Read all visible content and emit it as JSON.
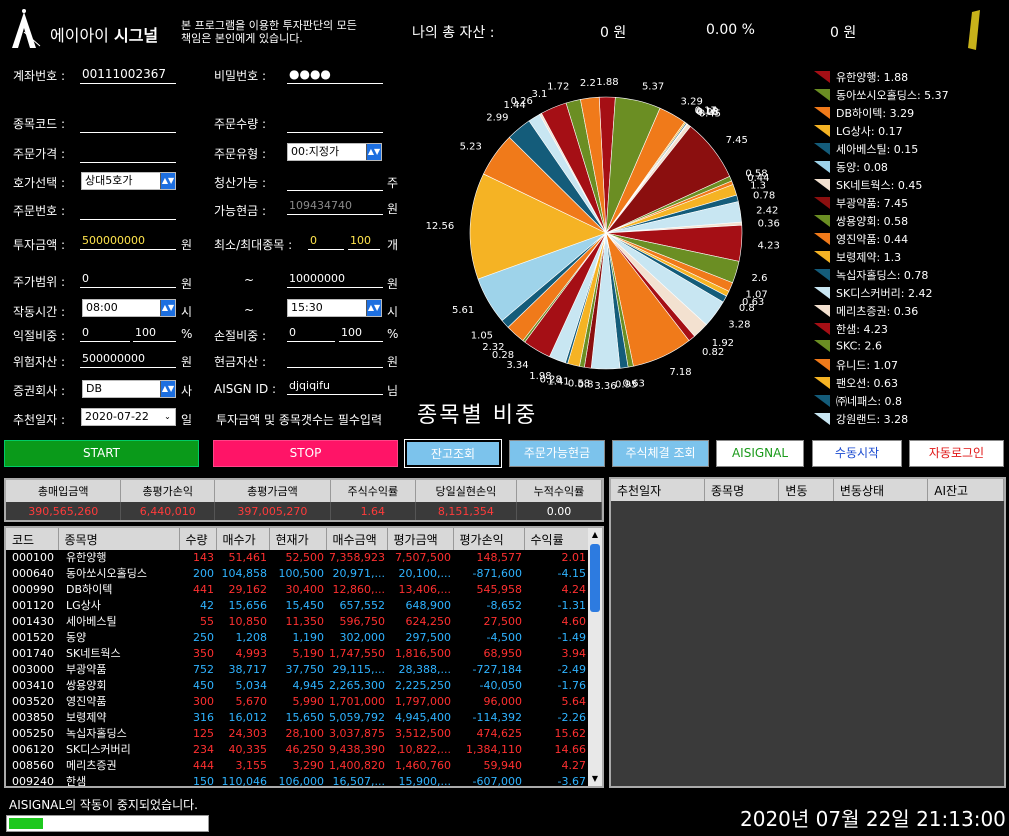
{
  "header": {
    "brand_ko": "에이아이",
    "brand_bold": "시그널",
    "disclaimer_line1": "본 프로그램을 이용한 투자판단의 모든",
    "disclaimer_line2": "책임은 본인에게 있습니다.",
    "total_asset_label": "나의 총 자산 :",
    "total_asset_value": "0 원",
    "total_rate": "0.00 %",
    "total_profit": "0 원"
  },
  "form": {
    "account_label": "계좌번호 :",
    "account_value": "00111002367",
    "password_label": "비밀번호 :",
    "password_value": "●●●●",
    "code_label": "종목코드 :",
    "code_value": "",
    "qty_label": "주문수량 :",
    "qty_value": "",
    "price_label": "주문가격 :",
    "price_value": "",
    "order_type_label": "주문유형 :",
    "order_type_value": "00:지정가",
    "hoga_label": "호가선택 :",
    "hoga_value": "상대5호가",
    "liquidation_label": "청산가능 :",
    "liquidation_value": "",
    "liquidation_unit": "주",
    "order_no_label": "주문번호 :",
    "order_no_value": "",
    "available_cash_label": "가능현금 :",
    "available_cash_value": "109434740",
    "available_cash_unit": "원",
    "invest_label": "투자금액 :",
    "invest_value": "500000000",
    "invest_unit": "원",
    "minmax_label": "최소/최대종목 :",
    "min_value": "0",
    "max_value": "100",
    "minmax_unit": "개",
    "price_range_label": "주가범위 :",
    "price_from": "0",
    "price_from_unit": "원",
    "tilde1": "~",
    "price_to": "10000000",
    "price_to_unit": "원",
    "time_label": "작동시간 :",
    "time_from": "08:00",
    "time_from_unit": "시",
    "tilde2": "~",
    "time_to": "15:30",
    "time_to_unit": "시",
    "takeprofit_label": "익절비중 :",
    "takeprofit_a": "0",
    "takeprofit_b": "100",
    "takeprofit_unit": "%",
    "stoploss_label": "손절비중 :",
    "stoploss_a": "0",
    "stoploss_b": "100",
    "stoploss_unit": "%",
    "risk_asset_label": "위험자산 :",
    "risk_asset_value": "500000000",
    "risk_asset_unit": "원",
    "cash_asset_label": "현금자산 :",
    "cash_asset_value": "",
    "cash_asset_unit": "원",
    "broker_label": "증권회사 :",
    "broker_value": "DB",
    "broker_unit": "사",
    "aisgn_label": "AISGN ID :",
    "aisgn_value": "djqiqifu",
    "aisgn_unit": "님",
    "recommend_label": "추천일자 :",
    "recommend_value": "2020-07-22",
    "recommend_unit": "일",
    "required_note": "투자금액 및 종목갯수는 필수입력"
  },
  "chart_title": "종목별 비중",
  "chart_data": {
    "type": "pie",
    "title": "종목별 비중",
    "slices": [
      {
        "label": "유한양행",
        "value": 1.88,
        "color": "#a50f15"
      },
      {
        "label": "동아쏘시오홀딩스",
        "value": 5.37,
        "color": "#6b8e23"
      },
      {
        "label": "DB하이텍",
        "value": 3.29,
        "color": "#f07a1a"
      },
      {
        "label": "LG상사",
        "value": 0.17,
        "color": "#f5b324"
      },
      {
        "label": "세아베스틸",
        "value": 0.15,
        "color": "#145c7a"
      },
      {
        "label": "동양",
        "value": 0.08,
        "color": "#9ed3ea"
      },
      {
        "label": "SK네트웍스",
        "value": 0.45,
        "color": "#f3e1d0"
      },
      {
        "label": "부광약품",
        "value": 7.45,
        "color": "#8b0f0f"
      },
      {
        "label": "쌍용양회",
        "value": 0.58,
        "color": "#6b8e23"
      },
      {
        "label": "영진약품",
        "value": 0.44,
        "color": "#f07a1a"
      },
      {
        "label": "보령제약",
        "value": 1.3,
        "color": "#f5b324"
      },
      {
        "label": "녹십자홀딩스",
        "value": 0.78,
        "color": "#145c7a"
      },
      {
        "label": "SK디스커버리",
        "value": 2.42,
        "color": "#c8e6f2"
      },
      {
        "label": "메리츠증권",
        "value": 0.36,
        "color": "#f3e1d0"
      },
      {
        "label": "한샘",
        "value": 4.23,
        "color": "#a50f15"
      },
      {
        "label": "SKC",
        "value": 2.6,
        "color": "#6b8e23"
      },
      {
        "label": "유니드",
        "value": 1.07,
        "color": "#f07a1a"
      },
      {
        "label": "팬오션",
        "value": 0.63,
        "color": "#f5b324"
      },
      {
        "label": "㈜네패스",
        "value": 0.8,
        "color": "#145c7a"
      },
      {
        "label": "강원랜드",
        "value": 3.28,
        "color": "#c8e6f2"
      },
      {
        "label": "",
        "value": 1.92,
        "color": "#f3e1d0"
      },
      {
        "label": "",
        "value": 0.82,
        "color": "#a50f15"
      },
      {
        "label": "",
        "value": 7.18,
        "color": "#f07a1a"
      },
      {
        "label": "",
        "value": 0.63,
        "color": "#6b8e23"
      },
      {
        "label": "",
        "value": 0.95,
        "color": "#145c7a"
      },
      {
        "label": "",
        "value": 3.36,
        "color": "#c8e6f2"
      },
      {
        "label": "",
        "value": 0.8,
        "color": "#8b0f0f"
      },
      {
        "label": "",
        "value": 0.58,
        "color": "#6b8e23"
      },
      {
        "label": "",
        "value": 1.41,
        "color": "#f5b324"
      },
      {
        "label": "",
        "value": 0.28,
        "color": "#145c7a"
      },
      {
        "label": "",
        "value": 1.98,
        "color": "#c8e6f2"
      },
      {
        "label": "",
        "value": 3.34,
        "color": "#a50f15"
      },
      {
        "label": "",
        "value": 0.28,
        "color": "#6b8e23"
      },
      {
        "label": "",
        "value": 2.32,
        "color": "#f07a1a"
      },
      {
        "label": "",
        "value": 1.05,
        "color": "#145c7a"
      },
      {
        "label": "",
        "value": 5.61,
        "color": "#9ed3ea"
      },
      {
        "label": "",
        "value": 12.56,
        "color": "#f5b324"
      },
      {
        "label": "",
        "value": 5.23,
        "color": "#f07a1a"
      },
      {
        "label": "",
        "value": 2.99,
        "color": "#145c7a"
      },
      {
        "label": "",
        "value": 1.44,
        "color": "#c8e6f2"
      },
      {
        "label": "",
        "value": 0.26,
        "color": "#f3e1d0"
      },
      {
        "label": "",
        "value": 3.1,
        "color": "#a50f15"
      },
      {
        "label": "",
        "value": 1.72,
        "color": "#6b8e23"
      },
      {
        "label": "",
        "value": 2.2,
        "color": "#f07a1a"
      }
    ],
    "legend_position": "right"
  },
  "buttons": {
    "start": "START",
    "stop": "STOP",
    "balance": "잔고조회",
    "order_cash": "주문가능현금",
    "filled": "주식체결 조회",
    "aisignal": "AISIGNAL",
    "manual": "수동시작",
    "autologin": "자동로그인"
  },
  "summary": {
    "headers": [
      "총매입금액",
      "총평가손익",
      "총평가금액",
      "주식수익률",
      "당일실현손익",
      "누적수익률"
    ],
    "values": [
      "390,565,260",
      "6,440,010",
      "397,005,270",
      "1.64",
      "8,151,354",
      "0.00"
    ]
  },
  "grid": {
    "headers": [
      "코드",
      "종목명",
      "수량",
      "매수가",
      "현재가",
      "매수금액",
      "평가금액",
      "평가손익",
      "수익률"
    ],
    "rows": [
      [
        "000100",
        "유한양행",
        "143",
        "51,461",
        "52,500",
        "7,358,923",
        "7,507,500",
        "148,577",
        "2.01",
        "red"
      ],
      [
        "000640",
        "동아쏘시오홀딩스",
        "200",
        "104,858",
        "100,500",
        "20,971,...",
        "20,100,...",
        "-871,600",
        "-4.15",
        "blue"
      ],
      [
        "000990",
        "DB하이텍",
        "441",
        "29,162",
        "30,400",
        "12,860,...",
        "13,406,...",
        "545,958",
        "4.24",
        "red"
      ],
      [
        "001120",
        "LG상사",
        "42",
        "15,656",
        "15,450",
        "657,552",
        "648,900",
        "-8,652",
        "-1.31",
        "blue"
      ],
      [
        "001430",
        "세아베스틸",
        "55",
        "10,850",
        "11,350",
        "596,750",
        "624,250",
        "27,500",
        "4.60",
        "red"
      ],
      [
        "001520",
        "동양",
        "250",
        "1,208",
        "1,190",
        "302,000",
        "297,500",
        "-4,500",
        "-1.49",
        "blue"
      ],
      [
        "001740",
        "SK네트웍스",
        "350",
        "4,993",
        "5,190",
        "1,747,550",
        "1,816,500",
        "68,950",
        "3.94",
        "red"
      ],
      [
        "003000",
        "부광약품",
        "752",
        "38,717",
        "37,750",
        "29,115,...",
        "28,388,...",
        "-727,184",
        "-2.49",
        "blue"
      ],
      [
        "003410",
        "쌍용양회",
        "450",
        "5,034",
        "4,945",
        "2,265,300",
        "2,225,250",
        "-40,050",
        "-1.76",
        "blue"
      ],
      [
        "003520",
        "영진약품",
        "300",
        "5,670",
        "5,990",
        "1,701,000",
        "1,797,000",
        "96,000",
        "5.64",
        "red"
      ],
      [
        "003850",
        "보령제약",
        "316",
        "16,012",
        "15,650",
        "5,059,792",
        "4,945,400",
        "-114,392",
        "-2.26",
        "blue"
      ],
      [
        "005250",
        "녹십자홀딩스",
        "125",
        "24,303",
        "28,100",
        "3,037,875",
        "3,512,500",
        "474,625",
        "15.62",
        "red"
      ],
      [
        "006120",
        "SK디스커버리",
        "234",
        "40,335",
        "46,250",
        "9,438,390",
        "10,822,...",
        "1,384,110",
        "14.66",
        "red"
      ],
      [
        "008560",
        "메리츠증권",
        "444",
        "3,155",
        "3,290",
        "1,400,820",
        "1,460,760",
        "59,940",
        "4.27",
        "red"
      ],
      [
        "009240",
        "한샘",
        "150",
        "110,046",
        "106,000",
        "16,507,...",
        "15,900,...",
        "-607,000",
        "-3.67",
        "blue"
      ]
    ]
  },
  "right_grid": {
    "headers": [
      "추천일자",
      "종목명",
      "변동",
      "변동상태",
      "AI잔고"
    ]
  },
  "status": {
    "message": "AISIGNAL의 작동이 중지되었습니다.",
    "datetime": "2020년 07월 22일 21:13:00",
    "progress": 0.17
  }
}
